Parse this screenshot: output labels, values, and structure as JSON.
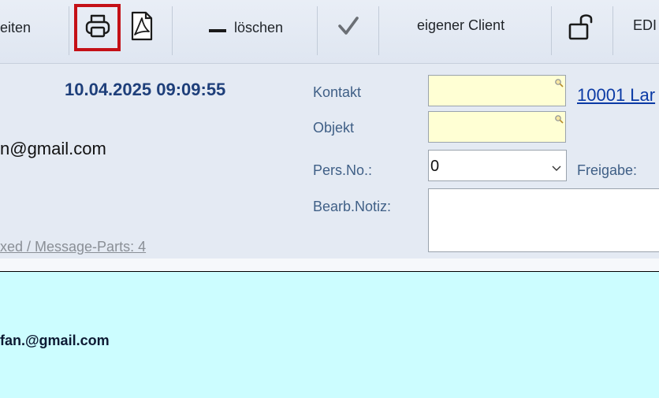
{
  "toolbar": {
    "edit_partial_label": "eiten",
    "print_icon": "printer-icon",
    "pdf_icon": "pdf-icon",
    "delete_label": "löschen",
    "confirm_icon": "checkmark-icon",
    "own_client_label": "eigener Client",
    "lock_icon": "unlock-icon",
    "edi_label": "EDI",
    "highlight_color": "#c41016"
  },
  "header": {
    "datetime": "10.04.2025 09:09:55",
    "email": "n@gmail.com",
    "message_parts": "xed / Message-Parts: 4"
  },
  "form": {
    "kontakt_label": "Kontakt",
    "objekt_label": "Objekt",
    "persno_label": "Pers.No.:",
    "persno_value": "0",
    "freigabe_label": "Freigabe:",
    "notiz_label": "Bearb.Notiz:",
    "kontakt_link": "10001 Lar",
    "lookup_icon": "magnifier-icon"
  },
  "body": {
    "email": "fan.@gmail.com",
    "background": "#ccfdff"
  }
}
